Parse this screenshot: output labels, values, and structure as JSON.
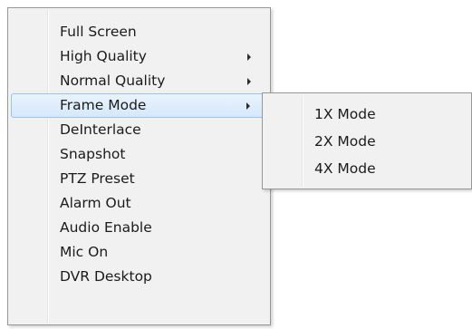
{
  "context_menu": {
    "items": [
      {
        "label": "Full Screen",
        "submenu": false
      },
      {
        "label": "High Quality",
        "submenu": true
      },
      {
        "label": "Normal Quality",
        "submenu": true
      },
      {
        "label": "Frame Mode",
        "submenu": true,
        "highlighted": true
      },
      {
        "label": "DeInterlace",
        "submenu": false
      },
      {
        "label": "Snapshot",
        "submenu": false
      },
      {
        "label": "PTZ Preset",
        "submenu": false
      },
      {
        "label": "Alarm Out",
        "submenu": false
      },
      {
        "label": "Audio Enable",
        "submenu": false
      },
      {
        "label": "Mic On",
        "submenu": false
      },
      {
        "label": "DVR Desktop",
        "submenu": false
      }
    ]
  },
  "frame_mode_submenu": {
    "items": [
      {
        "label": "1X Mode"
      },
      {
        "label": "2X Mode"
      },
      {
        "label": "4X Mode"
      }
    ]
  },
  "colors": {
    "menu_background": "#f1f1f1",
    "menu_border": "#979797",
    "highlight_fill": "#d5e8fb",
    "highlight_border": "#9ac3ed"
  }
}
